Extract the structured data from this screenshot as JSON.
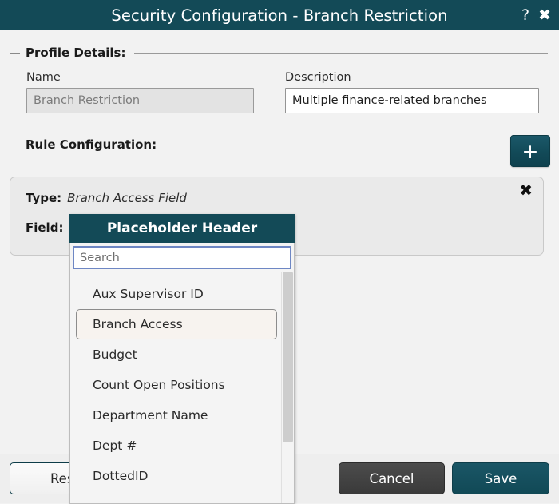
{
  "window": {
    "title": "Security Configuration - Branch Restriction",
    "help_icon": "?",
    "close_icon": "✖"
  },
  "profile_section": {
    "legend": "Profile Details:",
    "name_label": "Name",
    "name_value": "Branch Restriction",
    "name_placeholder": "Branch Restriction",
    "description_label": "Description",
    "description_value": "Multiple finance-related branches",
    "description_placeholder": "Description"
  },
  "rule_section": {
    "legend": "Rule Configuration:",
    "add_rule_icon": "+",
    "rule": {
      "type_label": "Type:",
      "type_value": "Branch Access Field",
      "field_label": "Field:",
      "remove_icon": "✖"
    }
  },
  "dropdown": {
    "header": "Placeholder Header",
    "search_value": "",
    "search_placeholder": "Search",
    "selected": "Branch Access",
    "items": [
      "Aux Supervisor ID",
      "Branch Access",
      "Budget",
      "Count Open Positions",
      "Department Name",
      "Dept #",
      "DottedID"
    ]
  },
  "footer": {
    "reset_label": "Reset",
    "cancel_label": "Cancel",
    "save_label": "Save"
  },
  "colors": {
    "teal": "#134a57",
    "window_bg": "#f2f2f2",
    "card_bg": "#eaeaea",
    "cancel_gray": "#434343",
    "selected_item_bg": "#f7f3ef"
  }
}
